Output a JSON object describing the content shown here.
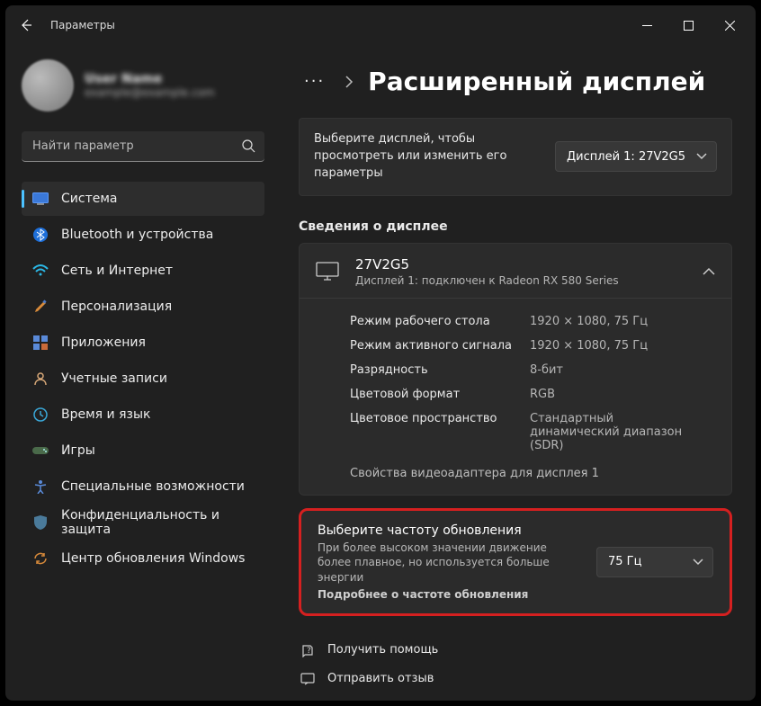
{
  "window_title": "Параметры",
  "account": {
    "name": "User Name",
    "email": "example@example.com"
  },
  "search": {
    "placeholder": "Найти параметр"
  },
  "sidebar": {
    "items": [
      {
        "label": "Система"
      },
      {
        "label": "Bluetooth и устройства"
      },
      {
        "label": "Сеть и Интернет"
      },
      {
        "label": "Персонализация"
      },
      {
        "label": "Приложения"
      },
      {
        "label": "Учетные записи"
      },
      {
        "label": "Время и язык"
      },
      {
        "label": "Игры"
      },
      {
        "label": "Специальные возможности"
      },
      {
        "label": "Конфиденциальность и защита"
      },
      {
        "label": "Центр обновления Windows"
      }
    ]
  },
  "breadcrumb": {
    "more": "···",
    "sep": "›",
    "title": "Расширенный дисплей"
  },
  "display_select": {
    "text": "Выберите дисплей, чтобы просмотреть или изменить его параметры",
    "value": "Дисплей 1: 27V2G5"
  },
  "display_info": {
    "heading": "Сведения о дисплее",
    "name": "27V2G5",
    "sub": "Дисплей 1: подключен к Radeon RX 580 Series",
    "rows": [
      {
        "k": "Режим рабочего стола",
        "v": "1920 × 1080, 75 Гц"
      },
      {
        "k": "Режим активного сигнала",
        "v": "1920 × 1080, 75 Гц"
      },
      {
        "k": "Разрядность",
        "v": "8-бит"
      },
      {
        "k": "Цветовой формат",
        "v": "RGB"
      },
      {
        "k": "Цветовое пространство",
        "v": "Стандартный динамический диапазон (SDR)"
      }
    ],
    "adapter_link": "Свойства видеоадаптера для дисплея 1"
  },
  "refresh_rate": {
    "title": "Выберите частоту обновления",
    "desc": "При более высоком значении движение более плавное, но используется больше энергии",
    "more": "Подробнее о частоте обновления",
    "value": "75 Гц"
  },
  "footer": {
    "help": "Получить помощь",
    "feedback": "Отправить отзыв"
  }
}
